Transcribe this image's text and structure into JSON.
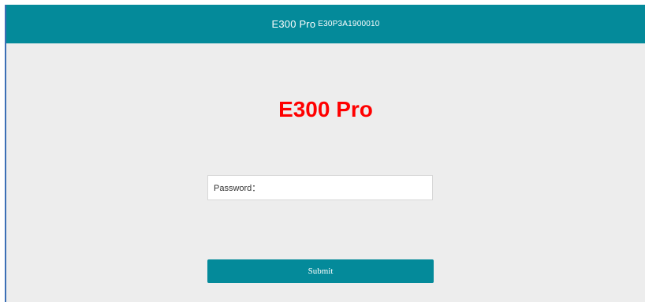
{
  "header": {
    "title": "E300 Pro",
    "serial": "E30P3A1900010"
  },
  "main": {
    "brand": "E300 Pro",
    "password": {
      "label": "Password：",
      "value": ""
    },
    "submit_label": "Submit"
  },
  "colors": {
    "accent": "#048a9a",
    "brand_text": "#ff0000",
    "background": "#ededed"
  }
}
